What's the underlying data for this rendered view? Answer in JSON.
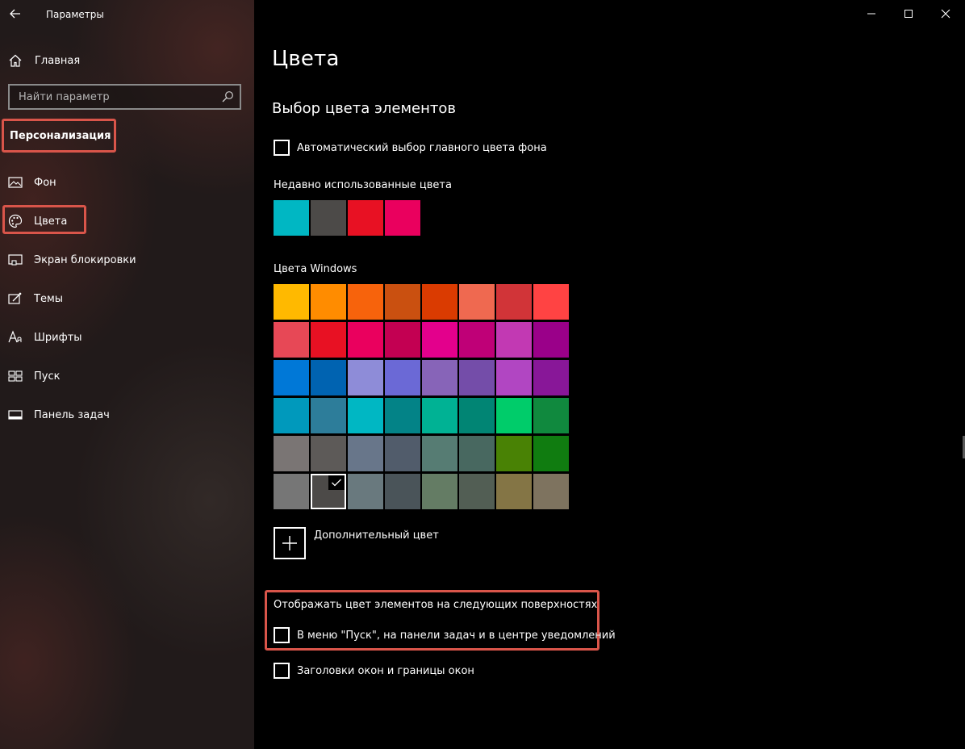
{
  "window": {
    "app_title": "Параметры",
    "controls": {
      "minimize": "minimize",
      "maximize": "maximize",
      "close": "close"
    }
  },
  "sidebar": {
    "home_label": "Главная",
    "search_placeholder": "Найти параметр",
    "section_title": "Персонализация",
    "items": [
      {
        "label": "Фон",
        "icon": "picture-icon"
      },
      {
        "label": "Цвета",
        "icon": "palette-icon",
        "active": true
      },
      {
        "label": "Экран блокировки",
        "icon": "lock-screen-icon"
      },
      {
        "label": "Темы",
        "icon": "themes-icon"
      },
      {
        "label": "Шрифты",
        "icon": "font-icon"
      },
      {
        "label": "Пуск",
        "icon": "start-icon"
      },
      {
        "label": "Панель задач",
        "icon": "taskbar-icon"
      }
    ],
    "highlight_color": "#d9554a"
  },
  "main": {
    "page_title": "Цвета",
    "section_title": "Выбор цвета элементов",
    "auto_color_label": "Автоматический выбор главного цвета фона",
    "auto_color_checked": false,
    "recent_label": "Недавно использованные цвета",
    "recent_colors": [
      "#00b7c3",
      "#4c4a48",
      "#e81123",
      "#ea005e"
    ],
    "windows_colors_label": "Цвета Windows",
    "windows_colors": [
      [
        "#ffb900",
        "#ff8c00",
        "#f7630c",
        "#ca5010",
        "#da3b01",
        "#ef6950",
        "#d13438",
        "#ff4343"
      ],
      [
        "#e74856",
        "#e81123",
        "#ea005e",
        "#c30052",
        "#e3008c",
        "#bf0077",
        "#c239b3",
        "#9a0089"
      ],
      [
        "#0078d7",
        "#0063b1",
        "#8e8cd8",
        "#6b69d6",
        "#8764b8",
        "#744da9",
        "#b146c2",
        "#881798"
      ],
      [
        "#0099bc",
        "#2d7d9a",
        "#00b7c3",
        "#038387",
        "#00b294",
        "#018574",
        "#00cc6a",
        "#10893e"
      ],
      [
        "#7a7574",
        "#5d5a58",
        "#68768a",
        "#515c6b",
        "#567c73",
        "#486860",
        "#498205",
        "#107c10"
      ],
      [
        "#767676",
        "#4c4a48",
        "#69797e",
        "#4a5459",
        "#647c64",
        "#525e54",
        "#847545",
        "#7e735f"
      ]
    ],
    "selected_color": {
      "row": 5,
      "col": 1
    },
    "custom_color_label": "Дополнительный цвет",
    "surfaces_label": "Отображать цвет элементов на следующих поверхностях",
    "surface_start_label": "В меню \"Пуск\", на панели задач и в центре уведомлений",
    "surface_start_checked": false,
    "surface_titlebar_label": "Заголовки окон и границы окон",
    "surface_titlebar_checked": false
  }
}
